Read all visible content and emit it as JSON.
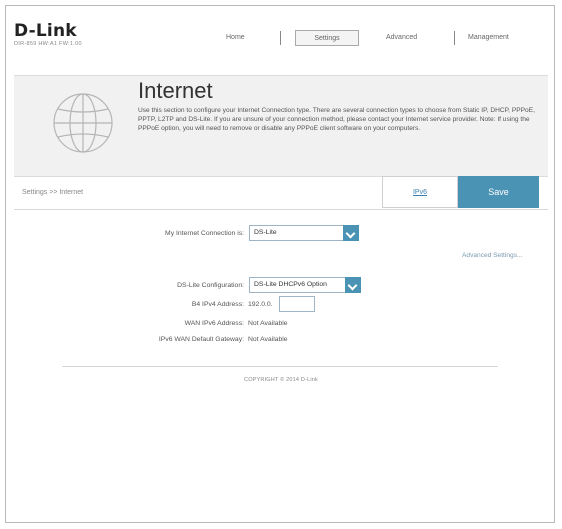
{
  "brand": {
    "logo": "D-Link",
    "model_info": "DIR-859  HW:A1  FW:1.00"
  },
  "nav": {
    "home": "Home",
    "settings": "Settings",
    "advanced": "Advanced",
    "management": "Management"
  },
  "page": {
    "title": "Internet",
    "description": "Use this section to configure your Internet Connection type. There are several connection types to choose from Static IP, DHCP, PPPoE, PPTP, L2TP and DS-Lite. If you are unsure of your connection method, please contact your Internet service provider. Note: If using the PPPoE option, you will need to remove or disable any PPPoE client software on your computers.",
    "breadcrumb": "Settings >> Internet",
    "ipv6_label": "IPv6",
    "save_label": "Save"
  },
  "form": {
    "connection_label": "My Internet Connection is:",
    "connection_value": "DS-Lite",
    "advanced_link": "Advanced Settings...",
    "dslite_config_label": "DS-Lite Configuration:",
    "dslite_config_value": "DS-Lite DHCPv6 Option",
    "b4_label": "B4 IPv4 Address:",
    "b4_prefix": "192.0.0.",
    "b4_value": "",
    "wan_ipv6_label": "WAN IPv6 Address:",
    "wan_ipv6_value": "Not Available",
    "ipv6_gw_label": "IPv6 WAN Default Gateway:",
    "ipv6_gw_value": "Not Available"
  },
  "footer": {
    "copyright": "COPYRIGHT © 2014 D-Link"
  },
  "colors": {
    "accent": "#4b93b5",
    "banner_bg": "#f1f1f1"
  },
  "icons": {
    "banner": "globe-icon",
    "dropdown": "chevron-down-icon"
  }
}
